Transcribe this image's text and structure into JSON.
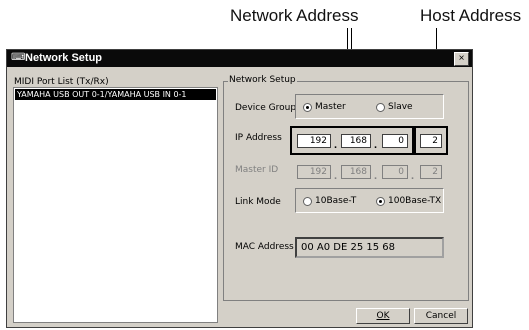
{
  "callouts": {
    "network_address": "Network Address",
    "host_address": "Host Address"
  },
  "window": {
    "title": "Network Setup",
    "close_label": "×"
  },
  "midi_port_list": {
    "label": "MIDI Port List (Tx/Rx)",
    "items": [
      "YAMAHA USB OUT 0-1/YAMAHA USB IN 0-1"
    ],
    "selected_index": 0
  },
  "network_setup": {
    "group_title": "Network Setup",
    "device_group": {
      "label": "Device Group",
      "options": [
        "Master",
        "Slave"
      ],
      "selected": "Master"
    },
    "ip_address": {
      "label": "IP Address",
      "octets": [
        "192",
        "168",
        "0",
        "2"
      ],
      "separator": "."
    },
    "master_id": {
      "label": "Master ID",
      "octets": [
        "192",
        "168",
        "0",
        "2"
      ],
      "separator": "."
    },
    "link_mode": {
      "label": "Link Mode",
      "options": [
        "10Base-T",
        "100Base-TX"
      ],
      "selected": "100Base-TX"
    },
    "mac_address": {
      "label": "MAC Address",
      "value": "00 A0 DE 25 15 68"
    }
  },
  "buttons": {
    "ok": "OK",
    "cancel": "Cancel"
  },
  "icons": {
    "title_icon": "midi-keyboard-icon",
    "close_icon": "close-icon"
  }
}
